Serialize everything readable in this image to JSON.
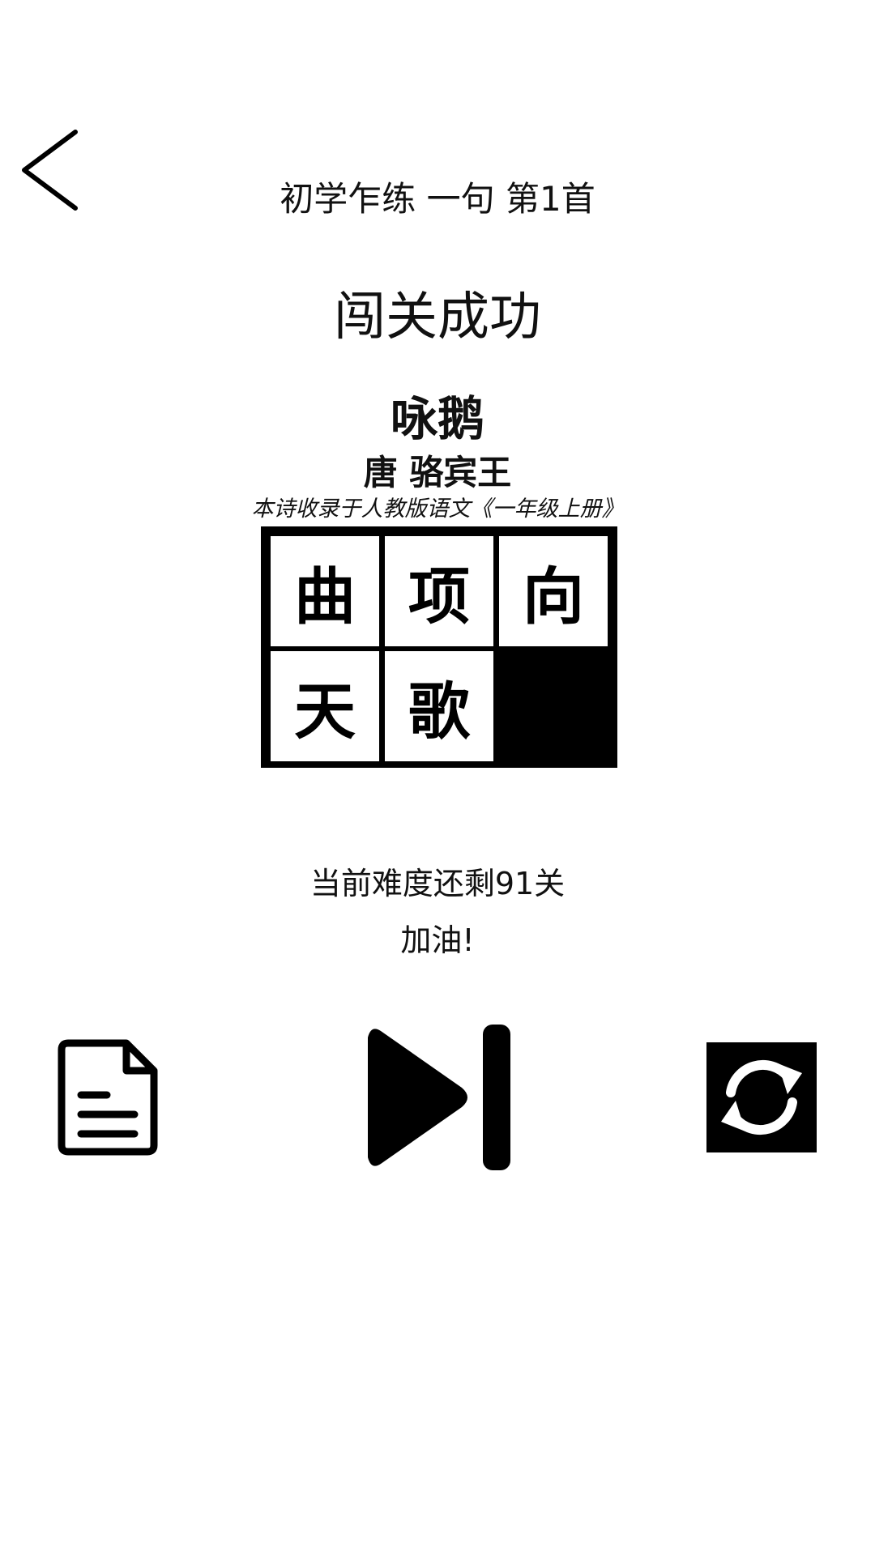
{
  "header": {
    "level_title": "初学乍练 一句 第1首"
  },
  "result": {
    "title": "闯关成功"
  },
  "poem": {
    "title": "咏鹅",
    "author": "唐 骆宾王",
    "source": "本诗收录于人教版语文《一年级上册》"
  },
  "grid": {
    "cells": [
      "曲",
      "项",
      "向",
      "天",
      "歌"
    ]
  },
  "status": {
    "remaining": "当前难度还剩91关",
    "cheer": "加油!"
  },
  "icons": {
    "back": "chevron-left-icon",
    "document": "document-icon",
    "next": "skip-next-icon",
    "restart": "refresh-icon"
  },
  "colors": {
    "background": "#ffffff",
    "foreground": "#000000"
  }
}
